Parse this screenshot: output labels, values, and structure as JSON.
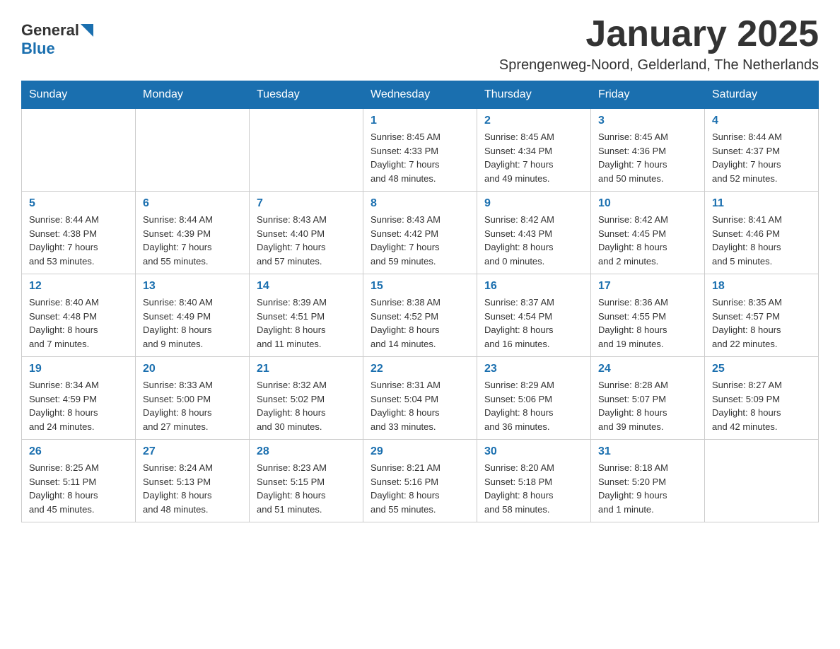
{
  "logo": {
    "text_general": "General",
    "text_blue": "Blue"
  },
  "title": "January 2025",
  "subtitle": "Sprengenweg-Noord, Gelderland, The Netherlands",
  "days_of_week": [
    "Sunday",
    "Monday",
    "Tuesday",
    "Wednesday",
    "Thursday",
    "Friday",
    "Saturday"
  ],
  "weeks": [
    [
      {
        "day": "",
        "info": ""
      },
      {
        "day": "",
        "info": ""
      },
      {
        "day": "",
        "info": ""
      },
      {
        "day": "1",
        "info": "Sunrise: 8:45 AM\nSunset: 4:33 PM\nDaylight: 7 hours\nand 48 minutes."
      },
      {
        "day": "2",
        "info": "Sunrise: 8:45 AM\nSunset: 4:34 PM\nDaylight: 7 hours\nand 49 minutes."
      },
      {
        "day": "3",
        "info": "Sunrise: 8:45 AM\nSunset: 4:36 PM\nDaylight: 7 hours\nand 50 minutes."
      },
      {
        "day": "4",
        "info": "Sunrise: 8:44 AM\nSunset: 4:37 PM\nDaylight: 7 hours\nand 52 minutes."
      }
    ],
    [
      {
        "day": "5",
        "info": "Sunrise: 8:44 AM\nSunset: 4:38 PM\nDaylight: 7 hours\nand 53 minutes."
      },
      {
        "day": "6",
        "info": "Sunrise: 8:44 AM\nSunset: 4:39 PM\nDaylight: 7 hours\nand 55 minutes."
      },
      {
        "day": "7",
        "info": "Sunrise: 8:43 AM\nSunset: 4:40 PM\nDaylight: 7 hours\nand 57 minutes."
      },
      {
        "day": "8",
        "info": "Sunrise: 8:43 AM\nSunset: 4:42 PM\nDaylight: 7 hours\nand 59 minutes."
      },
      {
        "day": "9",
        "info": "Sunrise: 8:42 AM\nSunset: 4:43 PM\nDaylight: 8 hours\nand 0 minutes."
      },
      {
        "day": "10",
        "info": "Sunrise: 8:42 AM\nSunset: 4:45 PM\nDaylight: 8 hours\nand 2 minutes."
      },
      {
        "day": "11",
        "info": "Sunrise: 8:41 AM\nSunset: 4:46 PM\nDaylight: 8 hours\nand 5 minutes."
      }
    ],
    [
      {
        "day": "12",
        "info": "Sunrise: 8:40 AM\nSunset: 4:48 PM\nDaylight: 8 hours\nand 7 minutes."
      },
      {
        "day": "13",
        "info": "Sunrise: 8:40 AM\nSunset: 4:49 PM\nDaylight: 8 hours\nand 9 minutes."
      },
      {
        "day": "14",
        "info": "Sunrise: 8:39 AM\nSunset: 4:51 PM\nDaylight: 8 hours\nand 11 minutes."
      },
      {
        "day": "15",
        "info": "Sunrise: 8:38 AM\nSunset: 4:52 PM\nDaylight: 8 hours\nand 14 minutes."
      },
      {
        "day": "16",
        "info": "Sunrise: 8:37 AM\nSunset: 4:54 PM\nDaylight: 8 hours\nand 16 minutes."
      },
      {
        "day": "17",
        "info": "Sunrise: 8:36 AM\nSunset: 4:55 PM\nDaylight: 8 hours\nand 19 minutes."
      },
      {
        "day": "18",
        "info": "Sunrise: 8:35 AM\nSunset: 4:57 PM\nDaylight: 8 hours\nand 22 minutes."
      }
    ],
    [
      {
        "day": "19",
        "info": "Sunrise: 8:34 AM\nSunset: 4:59 PM\nDaylight: 8 hours\nand 24 minutes."
      },
      {
        "day": "20",
        "info": "Sunrise: 8:33 AM\nSunset: 5:00 PM\nDaylight: 8 hours\nand 27 minutes."
      },
      {
        "day": "21",
        "info": "Sunrise: 8:32 AM\nSunset: 5:02 PM\nDaylight: 8 hours\nand 30 minutes."
      },
      {
        "day": "22",
        "info": "Sunrise: 8:31 AM\nSunset: 5:04 PM\nDaylight: 8 hours\nand 33 minutes."
      },
      {
        "day": "23",
        "info": "Sunrise: 8:29 AM\nSunset: 5:06 PM\nDaylight: 8 hours\nand 36 minutes."
      },
      {
        "day": "24",
        "info": "Sunrise: 8:28 AM\nSunset: 5:07 PM\nDaylight: 8 hours\nand 39 minutes."
      },
      {
        "day": "25",
        "info": "Sunrise: 8:27 AM\nSunset: 5:09 PM\nDaylight: 8 hours\nand 42 minutes."
      }
    ],
    [
      {
        "day": "26",
        "info": "Sunrise: 8:25 AM\nSunset: 5:11 PM\nDaylight: 8 hours\nand 45 minutes."
      },
      {
        "day": "27",
        "info": "Sunrise: 8:24 AM\nSunset: 5:13 PM\nDaylight: 8 hours\nand 48 minutes."
      },
      {
        "day": "28",
        "info": "Sunrise: 8:23 AM\nSunset: 5:15 PM\nDaylight: 8 hours\nand 51 minutes."
      },
      {
        "day": "29",
        "info": "Sunrise: 8:21 AM\nSunset: 5:16 PM\nDaylight: 8 hours\nand 55 minutes."
      },
      {
        "day": "30",
        "info": "Sunrise: 8:20 AM\nSunset: 5:18 PM\nDaylight: 8 hours\nand 58 minutes."
      },
      {
        "day": "31",
        "info": "Sunrise: 8:18 AM\nSunset: 5:20 PM\nDaylight: 9 hours\nand 1 minute."
      },
      {
        "day": "",
        "info": ""
      }
    ]
  ]
}
